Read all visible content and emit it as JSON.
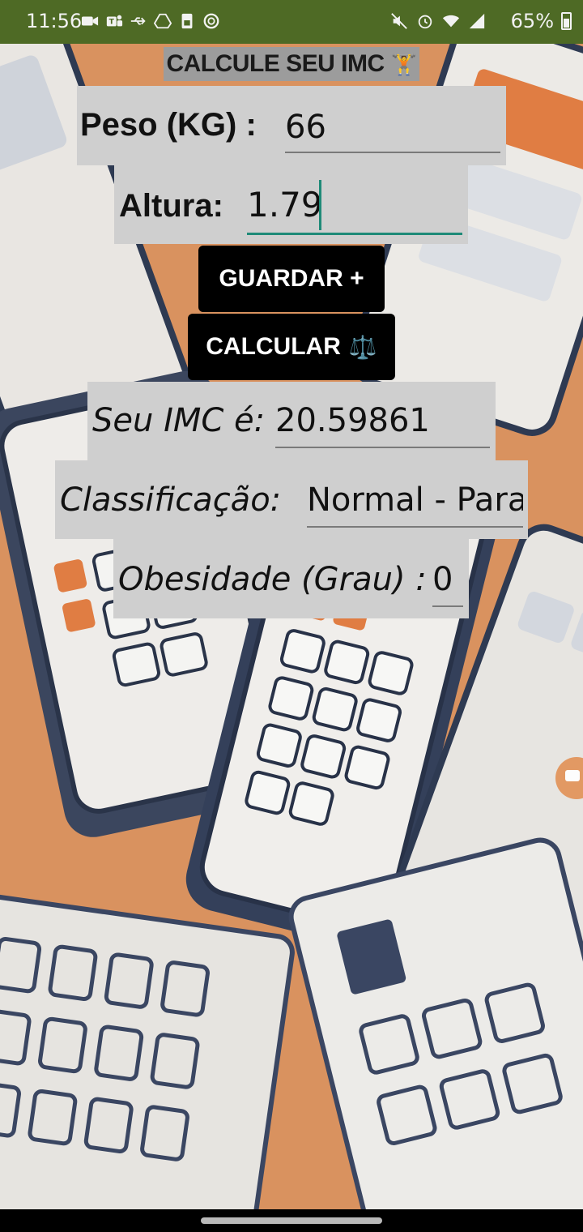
{
  "status_bar": {
    "time": "11:56",
    "battery_percent": "65%",
    "left_icons": [
      "video-camera-icon",
      "teams-icon",
      "usb-icon",
      "drive-icon",
      "sim-icon",
      "vpn-icon"
    ],
    "right_icons": [
      "mute-icon",
      "alarm-icon",
      "wifi-icon",
      "signal-icon"
    ]
  },
  "header": {
    "title": "CALCULE SEU IMC",
    "title_emoji": "🏋️"
  },
  "form": {
    "weight_label": "Peso (KG) :",
    "weight_value": "66",
    "height_label": "Altura:",
    "height_value": "1.79"
  },
  "buttons": {
    "save_label": "GUARDAR +",
    "calculate_label": "CALCULAR",
    "calculate_emoji": "⚖️"
  },
  "results": {
    "bmi_label": "Seu IMC é:",
    "bmi_value": "20.59861",
    "classification_label": "Classificação:",
    "classification_value": "Normal - Para",
    "obesity_label": "Obesidade (Grau) :",
    "obesity_value": "0"
  },
  "colors": {
    "status_bar": "#4e6a25",
    "panel": "#cfcfcf",
    "title_bg": "#9c9c9c",
    "button": "#000000",
    "accent": "#1f8a78"
  }
}
